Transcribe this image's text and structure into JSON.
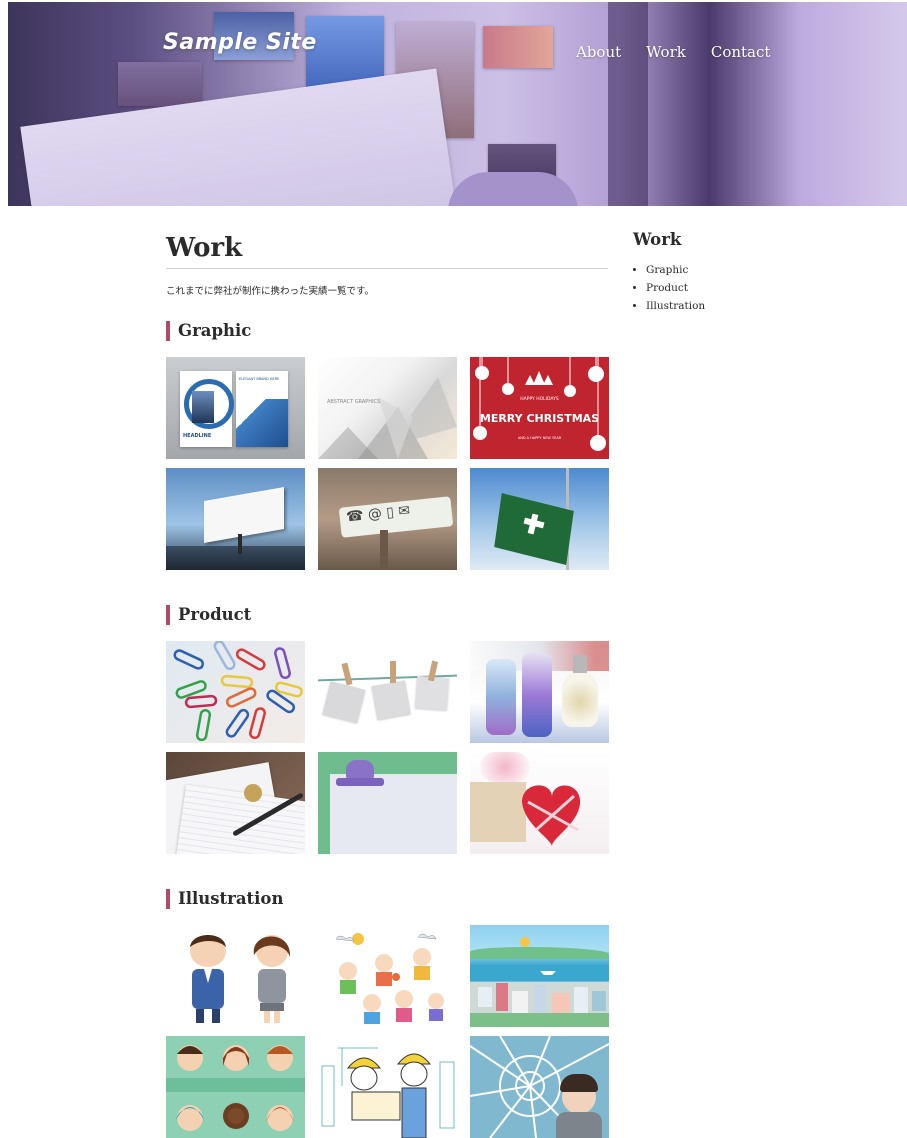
{
  "site": {
    "logo": "Sample Site"
  },
  "nav": [
    {
      "label": "About"
    },
    {
      "label": "Work"
    },
    {
      "label": "Contact"
    }
  ],
  "page": {
    "title": "Work",
    "lead": "これまでに弊社が制作に携わった実績一覧です。"
  },
  "sections": [
    {
      "title": "Graphic",
      "images": [
        {
          "icon": "brochure-image",
          "text": "HEADLINE",
          "text2": "ELEGANT BRAND HERE"
        },
        {
          "icon": "abstract-graphics-image",
          "text": "ABSTRACT GRAPHICS"
        },
        {
          "icon": "christmas-card-image",
          "text": "HAPPY HOLIDAYS",
          "text2": "MERRY CHRISTMAS",
          "text3": "AND A HAPPY NEW YEAR"
        },
        {
          "icon": "billboard-image"
        },
        {
          "icon": "contact-sign-image",
          "text": "☎ @ ▯ ✉"
        },
        {
          "icon": "flag-image"
        }
      ]
    },
    {
      "title": "Product",
      "images": [
        {
          "icon": "paper-clips-image"
        },
        {
          "icon": "hanging-notes-image"
        },
        {
          "icon": "herbarium-bottles-image"
        },
        {
          "icon": "letter-and-pen-image"
        },
        {
          "icon": "clipboard-image"
        },
        {
          "icon": "heart-gift-box-image"
        }
      ]
    },
    {
      "title": "Illustration",
      "images": [
        {
          "icon": "business-people-image"
        },
        {
          "icon": "kids-playing-image"
        },
        {
          "icon": "city-landscape-image"
        },
        {
          "icon": "diverse-faces-image"
        },
        {
          "icon": "construction-workers-image"
        },
        {
          "icon": "broken-glass-image"
        }
      ]
    }
  ],
  "sidebar": {
    "title": "Work",
    "items": [
      {
        "label": "Graphic"
      },
      {
        "label": "Product"
      },
      {
        "label": "Illustration"
      }
    ]
  },
  "colors": {
    "accent": "#b24a6a",
    "text": "#2b2b2b",
    "rule": "#cfcfcf"
  }
}
